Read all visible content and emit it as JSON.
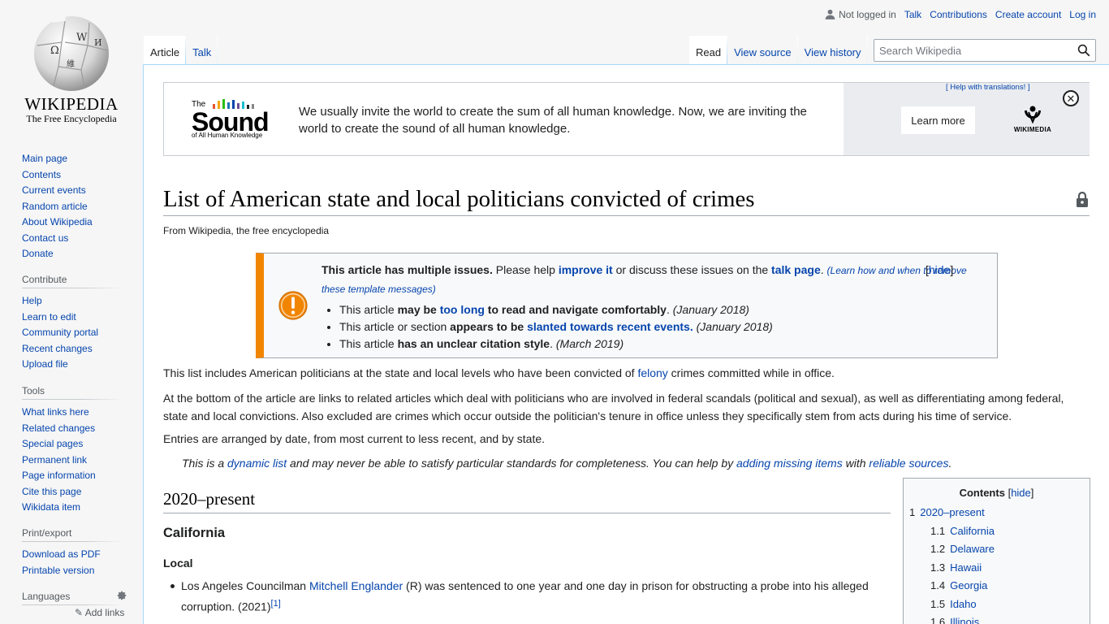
{
  "logo": {
    "wordmark": "WIKIPEDIA",
    "tagline": "The Free Encyclopedia"
  },
  "personal": {
    "not_logged_in": "Not logged in",
    "links": [
      "Talk",
      "Contributions",
      "Create account",
      "Log in"
    ]
  },
  "sidebar": {
    "navigation": [
      "Main page",
      "Contents",
      "Current events",
      "Random article",
      "About Wikipedia",
      "Contact us",
      "Donate"
    ],
    "contribute": {
      "heading": "Contribute",
      "items": [
        "Help",
        "Learn to edit",
        "Community portal",
        "Recent changes",
        "Upload file"
      ]
    },
    "tools": {
      "heading": "Tools",
      "items": [
        "What links here",
        "Related changes",
        "Special pages",
        "Permanent link",
        "Page information",
        "Cite this page",
        "Wikidata item"
      ]
    },
    "print": {
      "heading": "Print/export",
      "items": [
        "Download as PDF",
        "Printable version"
      ]
    },
    "languages": {
      "heading": "Languages",
      "add_links": "Add links"
    }
  },
  "tabs": {
    "left": [
      "Article",
      "Talk"
    ],
    "right": [
      "Read",
      "View source",
      "View history"
    ]
  },
  "search": {
    "placeholder": "Search Wikipedia"
  },
  "banner": {
    "logo_the": "The",
    "logo_word": "Sound",
    "logo_sub": "of All Human Knowledge",
    "message": "We usually invite the world to create the sum of all human knowledge. Now, we are inviting the world to create the sound of all human knowledge.",
    "help_translations": "[ Help with translations! ]",
    "learn_more": "Learn more",
    "wikimedia": "WIKIMEDIA",
    "close": "✕",
    "bar_colors": [
      "#e4572e",
      "#f3a712",
      "#29bf12",
      "#1f77b4",
      "#0645ad",
      "#6a4c93",
      "#17becf",
      "#202122",
      "#888888"
    ]
  },
  "page": {
    "title": "List of American state and local politicians convicted of crimes",
    "from": "From Wikipedia, the free encyclopedia"
  },
  "ambox": {
    "bold": "This article has multiple issues.",
    "t1": " Please help ",
    "improve": "improve it",
    "t2": " or discuss these issues on the ",
    "talk": "talk page",
    "t3": ". ",
    "learn": "(Learn how and when to remove these template messages)",
    "hide": "hide",
    "items": [
      {
        "a": "This article ",
        "b": "may be ",
        "link": "too long",
        "c": " to read and navigate comfortably",
        "d": ". ",
        "date": "(January 2018)"
      },
      {
        "a": "This article or section ",
        "b": "appears to be ",
        "link": "slanted towards recent events.",
        "c": "",
        "d": " ",
        "date": "(January 2018)"
      },
      {
        "a": "This article ",
        "b": "has an unclear citation style",
        "link": "",
        "c": "",
        "d": ". ",
        "date": "(March 2019)"
      }
    ]
  },
  "body": {
    "p1_a": "This list includes American politicians at the state and local levels who have been convicted of ",
    "p1_link": "felony",
    "p1_b": " crimes committed while in office.",
    "p2": "At the bottom of the article are links to related articles which deal with politicians who are involved in federal scandals (political and sexual), as well as differentiating among federal, state and local convictions. Also excluded are crimes which occur outside the politician's tenure in office unless they specifically stem from acts during his time of service.",
    "p3": "Entries are arranged by date, from most current to less recent, and by state.",
    "hat_a": "This is a ",
    "hat_link1": "dynamic list",
    "hat_b": " and may never be able to satisfy particular standards for completeness. You can help by ",
    "hat_link2": "adding missing items",
    "hat_c": " with ",
    "hat_link3": "reliable sources",
    "hat_d": ".",
    "h2": "2020–present",
    "h3": "California",
    "h4": "Local",
    "item_a": "Los Angeles Councilman ",
    "item_link": "Mitchell Englander",
    "item_b": " (R) was sentenced to one year and one day in prison for obstructing a probe into his alleged corruption. (2021)",
    "item_ref": "[1]"
  },
  "toc": {
    "title": "Contents",
    "hide": "hide",
    "entries": [
      {
        "num": "1",
        "label": "2020–present",
        "level": 1
      },
      {
        "num": "1.1",
        "label": "California",
        "level": 2
      },
      {
        "num": "1.2",
        "label": "Delaware",
        "level": 2
      },
      {
        "num": "1.3",
        "label": "Hawaii",
        "level": 2
      },
      {
        "num": "1.4",
        "label": "Georgia",
        "level": 2
      },
      {
        "num": "1.5",
        "label": "Idaho",
        "level": 2
      },
      {
        "num": "1.6",
        "label": "Illinois",
        "level": 2
      }
    ]
  }
}
